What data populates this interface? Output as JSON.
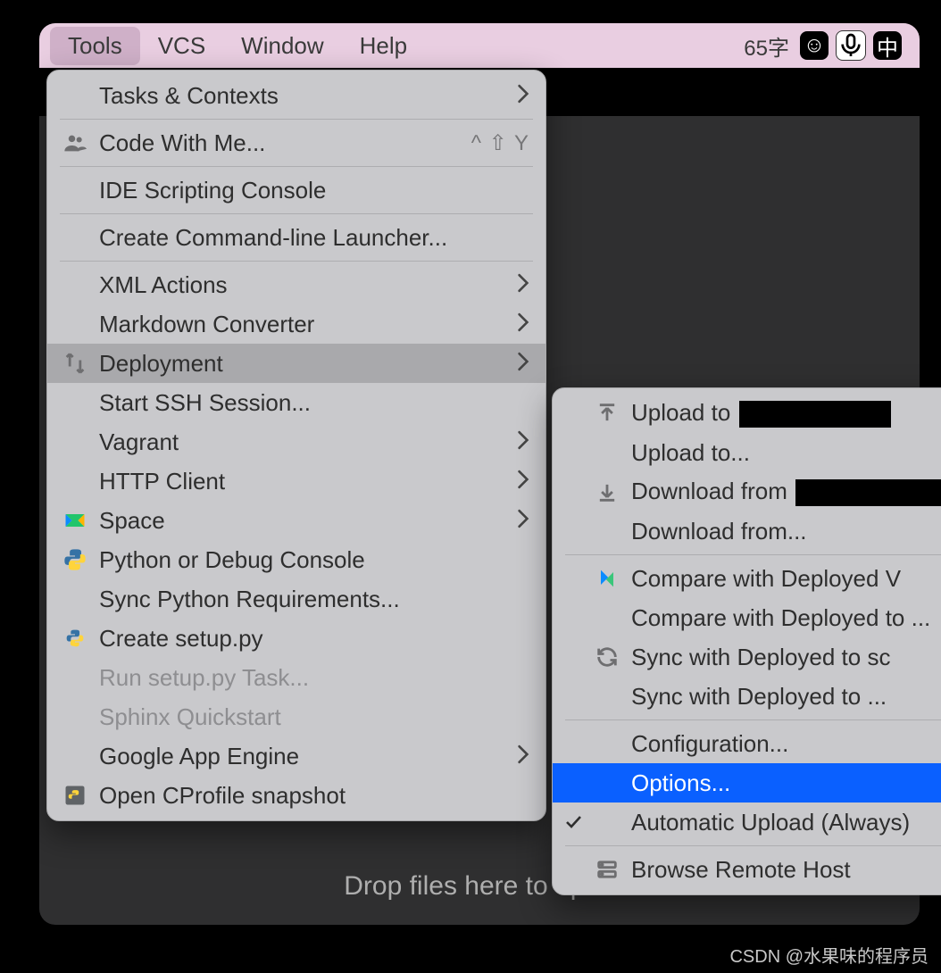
{
  "menubar": {
    "items": [
      "Tools",
      "VCS",
      "Window",
      "Help"
    ],
    "selected": 0,
    "status_text": "65字"
  },
  "drop_text": "Drop files here to open",
  "tools_menu": {
    "groups": [
      [
        {
          "label": "Tasks & Contexts",
          "submenu": true
        }
      ],
      [
        {
          "label": "Code With Me...",
          "icon": "people",
          "shortcut": "^ ⇧ Y"
        }
      ],
      [
        {
          "label": "IDE Scripting Console"
        }
      ],
      [
        {
          "label": "Create Command-line Launcher..."
        }
      ],
      [
        {
          "label": "XML Actions",
          "submenu": true
        },
        {
          "label": "Markdown Converter",
          "submenu": true
        },
        {
          "label": "Deployment",
          "icon": "deploy",
          "submenu": true,
          "hover": true
        },
        {
          "label": "Start SSH Session..."
        },
        {
          "label": "Vagrant",
          "submenu": true
        },
        {
          "label": "HTTP Client",
          "submenu": true
        },
        {
          "label": "Space",
          "icon": "space",
          "submenu": true
        },
        {
          "label": "Python or Debug Console",
          "icon": "python"
        },
        {
          "label": "Sync Python Requirements..."
        },
        {
          "label": "Create setup.py",
          "icon": "pyfile"
        },
        {
          "label": "Run setup.py Task...",
          "disabled": true
        },
        {
          "label": "Sphinx Quickstart",
          "disabled": true
        },
        {
          "label": "Google App Engine",
          "submenu": true
        },
        {
          "label": "Open CProfile snapshot",
          "icon": "cprofile"
        }
      ]
    ]
  },
  "deployment_submenu": {
    "groups": [
      [
        {
          "label": "Upload to ",
          "icon": "upload",
          "redact": true
        },
        {
          "label": "Upload to..."
        },
        {
          "label": "Download from ",
          "icon": "download",
          "redact": true
        },
        {
          "label": "Download from..."
        }
      ],
      [
        {
          "label": "Compare with Deployed V",
          "icon": "compare",
          "truncated": true
        },
        {
          "label": "Compare with Deployed to ..."
        },
        {
          "label": "Sync with Deployed to sc",
          "icon": "sync",
          "truncated": true
        },
        {
          "label": "Sync with Deployed to ..."
        }
      ],
      [
        {
          "label": "Configuration..."
        },
        {
          "label": "Options...",
          "selected": true
        },
        {
          "label": "Automatic Upload (Always)",
          "checked": true
        }
      ],
      [
        {
          "label": "Browse Remote Host",
          "icon": "browse"
        }
      ]
    ]
  },
  "watermark": "CSDN @水果味的程序员"
}
